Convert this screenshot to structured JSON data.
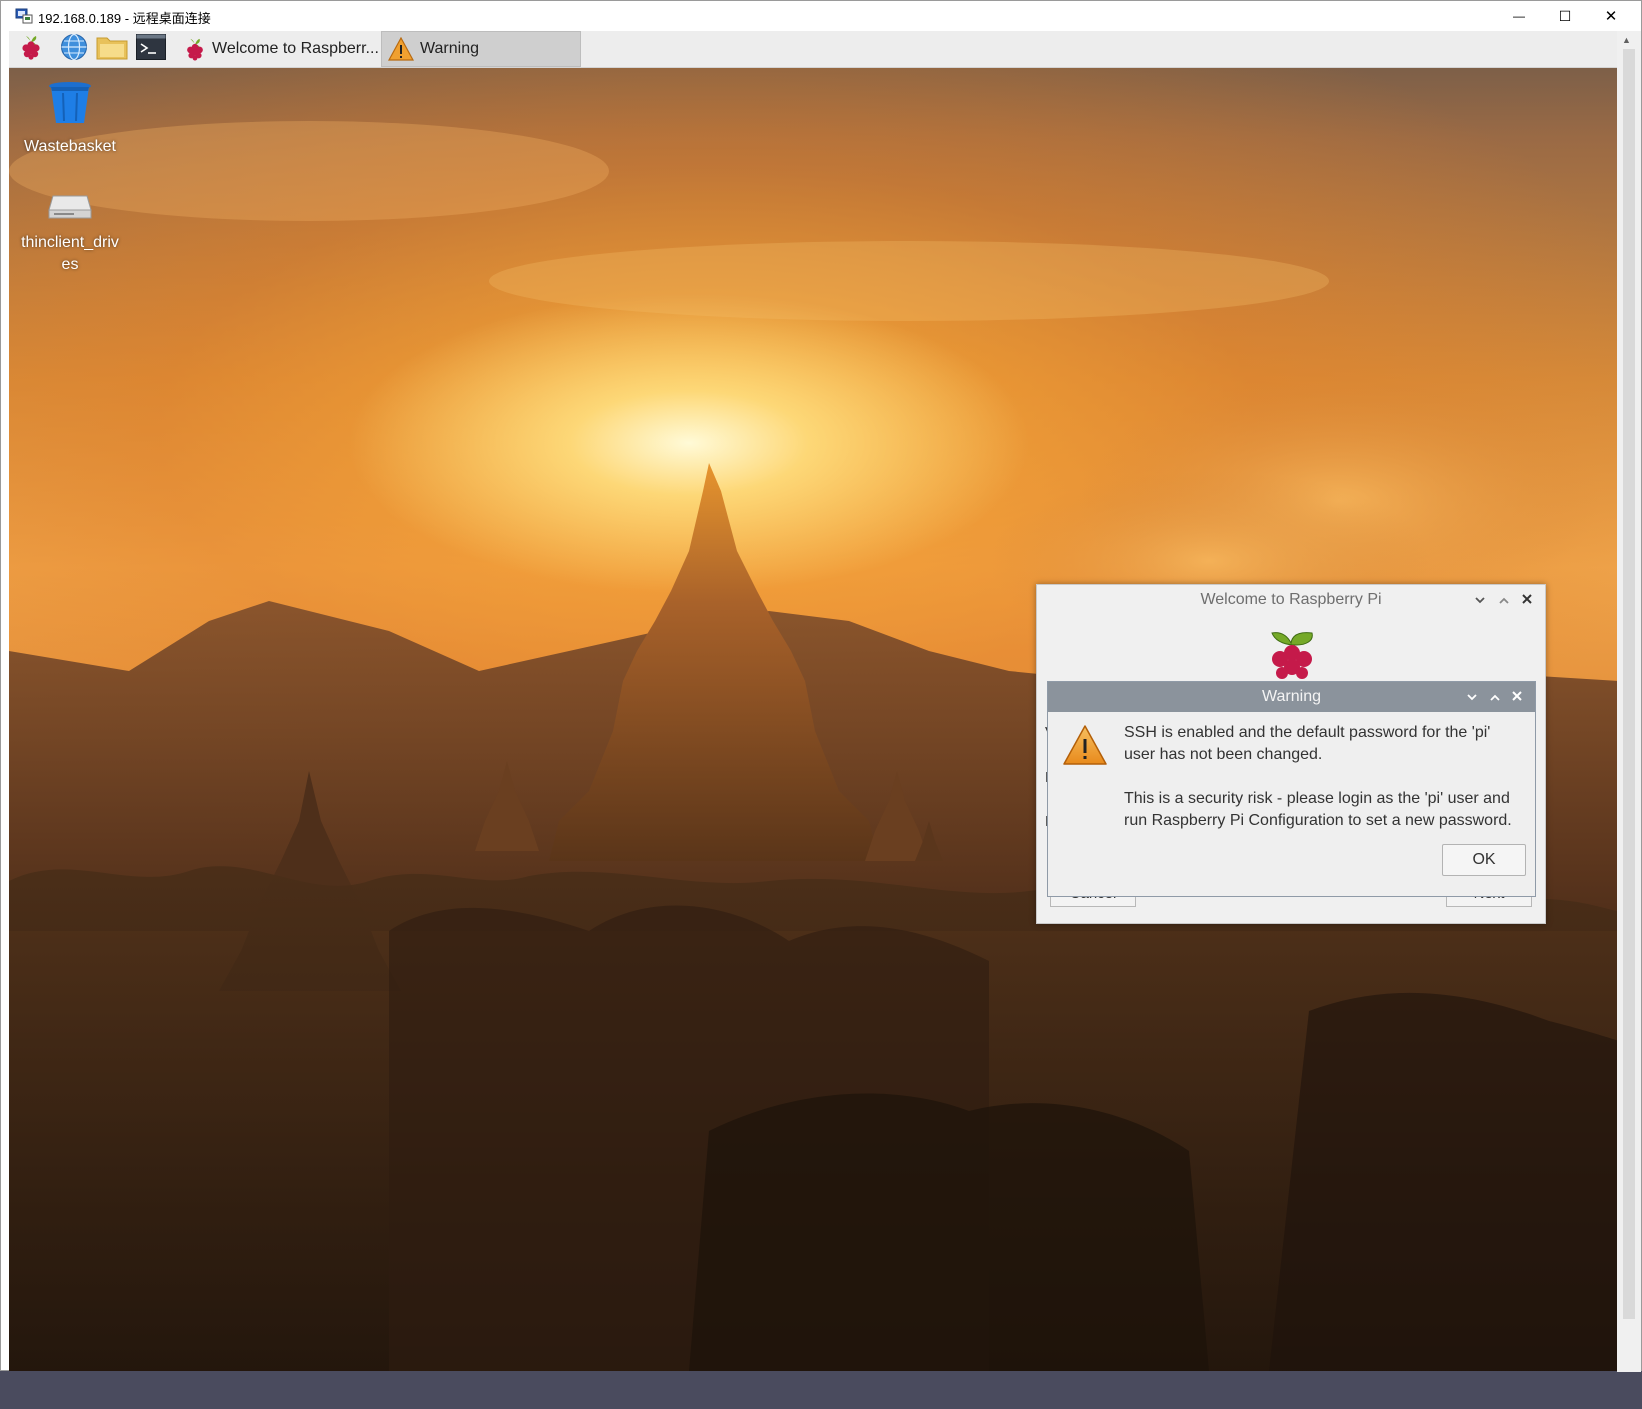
{
  "rdp": {
    "title": "192.168.0.189 - 远程桌面连接",
    "minimize_glyph": "—",
    "maximize_glyph": "☐",
    "close_glyph": "✕"
  },
  "taskbar": {
    "launchers": [
      {
        "name": "raspberry-menu-icon"
      },
      {
        "name": "web-browser-icon"
      },
      {
        "name": "file-manager-icon"
      },
      {
        "name": "terminal-icon"
      }
    ],
    "tasks": [
      {
        "label": "Welcome to Raspberr...",
        "icon": "raspberry-icon",
        "active": false
      },
      {
        "label": "Warning",
        "icon": "warning-icon",
        "active": true
      }
    ]
  },
  "desktop_icons": [
    {
      "label": "Wastebasket",
      "icon": "wastebasket-icon"
    },
    {
      "label": "thinclient_drives",
      "icon": "drive-icon"
    }
  ],
  "welcome_dialog": {
    "title": "Welcome to Raspberry Pi",
    "cancel_label": "Cancel",
    "next_label": "Next"
  },
  "warning_dialog": {
    "title": "Warning",
    "message_1": "SSH is enabled and the default password for the 'pi' user has not been changed.",
    "message_2": "This is a security risk - please login as the 'pi' user and run Raspberry Pi Configuration to set a new password.",
    "ok_label": "OK"
  },
  "colors": {
    "dialog_title_active": "#8b939c",
    "taskbar": "#ededed",
    "raspberry_red": "#c51a4a",
    "raspberry_leaf": "#75a928"
  }
}
